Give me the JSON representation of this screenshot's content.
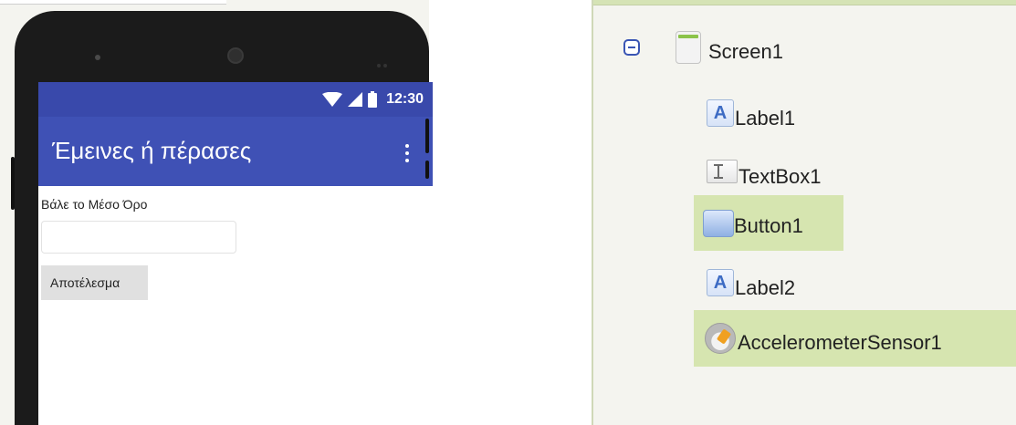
{
  "viewer": {
    "status_time": "12:30",
    "app_title": "Έμεινες ή πέρασες",
    "label1_text": "Βάλε το Μέσο Όρο",
    "textbox1_value": "",
    "button1_text": "Αποτέλεσμα"
  },
  "components": {
    "items": [
      {
        "label": "Screen1",
        "icon": "screen-icon",
        "selected": false
      },
      {
        "label": "Label1",
        "icon": "label-icon",
        "selected": false
      },
      {
        "label": "TextBox1",
        "icon": "textbox-icon",
        "selected": false
      },
      {
        "label": "Button1",
        "icon": "button-icon",
        "selected": true
      },
      {
        "label": "Label2",
        "icon": "label-icon",
        "selected": false
      },
      {
        "label": "AccelerometerSensor1",
        "icon": "accelerometer-icon",
        "selected": true
      }
    ],
    "label_icon_glyph": "A"
  },
  "colors": {
    "status_bar": "#3949ab",
    "app_bar": "#3f51b5",
    "selection": "#d6e5b0",
    "panel_background": "#f4f4ef"
  }
}
